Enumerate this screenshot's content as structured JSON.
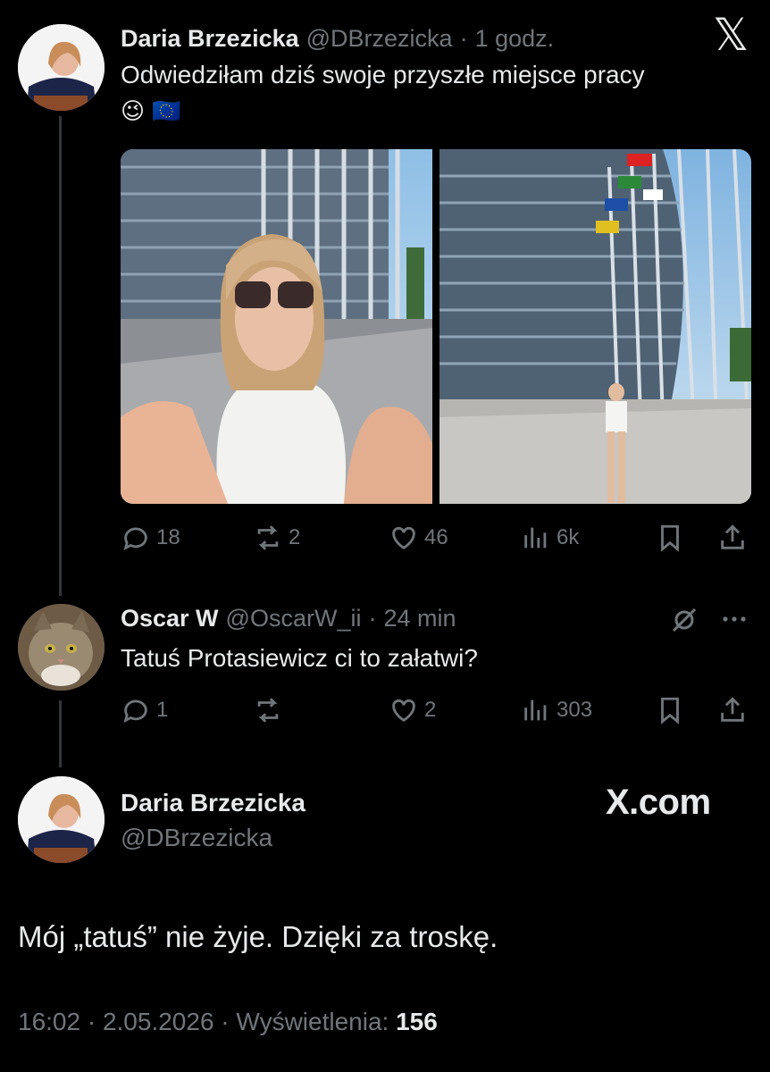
{
  "tweet1": {
    "name": "Daria Brzezicka",
    "handle": "@DBrzezicka",
    "time": "1 godz.",
    "text": "Odwiedziłam dziś swoje przyszłe miejsce pracy",
    "emoji": "😉 🇪🇺",
    "counts": {
      "replies": "18",
      "reposts": "2",
      "likes": "46",
      "views": "6k"
    }
  },
  "tweet2": {
    "name": "Oscar W",
    "handle": "@OscarW_ii",
    "time": "24 min",
    "text": "Tatuś Protasiewicz ci to załatwi?",
    "counts": {
      "replies": "1",
      "reposts": "",
      "likes": "2",
      "views": "303"
    }
  },
  "tweet3": {
    "name": "Daria Brzezicka",
    "handle": "@DBrzezicka",
    "brand": "X.com",
    "text": "Mój „tatuś” nie żyje. Dzięki za troskę.",
    "timestamp": "16:02 · 2.05.2026 · ",
    "views_label": "Wyświetlenia: ",
    "views_value": "156"
  },
  "separator": "·",
  "x_logo": "𝕏",
  "icons": {
    "reply": "reply-icon",
    "repost": "repost-icon",
    "like": "heart-icon",
    "views": "views-icon",
    "bookmark": "bookmark-icon",
    "share": "share-icon",
    "more": "more-icon",
    "grok": "grok-icon"
  }
}
